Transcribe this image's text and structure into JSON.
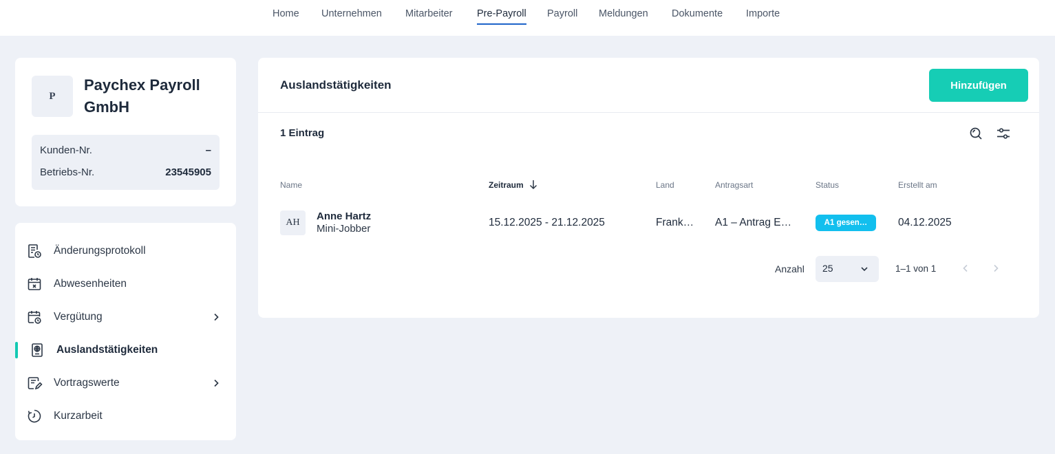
{
  "nav": {
    "items": [
      "Home",
      "Unternehmen",
      "Mitarbeiter",
      "Pre-Payroll",
      "Payroll",
      "Meldungen",
      "Dokumente",
      "Importe"
    ],
    "active": "Pre-Payroll"
  },
  "company": {
    "logo_letter": "P",
    "name": "Paychex Payroll GmbH",
    "customer_label": "Kunden-Nr.",
    "customer_value": "–",
    "plant_label": "Betriebs-Nr.",
    "plant_value": "23545905"
  },
  "sidebar": {
    "items": [
      {
        "label": "Änderungsprotokoll",
        "icon": "change-log-icon"
      },
      {
        "label": "Abwesenheiten",
        "icon": "calendar-x-icon"
      },
      {
        "label": "Vergütung",
        "icon": "calendar-clock-icon",
        "has_submenu": true
      },
      {
        "label": "Auslandstätigkeiten",
        "icon": "passport-globe-icon",
        "active": true
      },
      {
        "label": "Vortragswerte",
        "icon": "note-edit-icon",
        "has_submenu": true
      },
      {
        "label": "Kurzarbeit",
        "icon": "timer-icon"
      }
    ],
    "accent_color": "#13c9b3"
  },
  "main": {
    "title": "Auslandstätigkeiten",
    "add_button": "Hinzufügen",
    "add_button_color": "#16cdb5",
    "entry_count": "1 Eintrag",
    "tools": [
      "search-icon",
      "filter-sliders-icon"
    ],
    "columns": {
      "name": "Name",
      "period": "Zeitraum",
      "country": "Land",
      "request_type": "Antragsart",
      "status": "Status",
      "created": "Erstellt am"
    },
    "sort_column": "Zeitraum",
    "rows": [
      {
        "initials": "AH",
        "name": "Anne Hartz",
        "type": "Mini-Jobber",
        "period": "15.12.2025 - 21.12.2025",
        "country": "Frank…",
        "request_type": "A1 – Antrag E…",
        "status": "A1 gesen…",
        "status_color": "#12bfee",
        "created": "04.12.2025"
      }
    ],
    "pager": {
      "label": "Anzahl",
      "page_size": "25",
      "range": "1–1 von 1"
    }
  }
}
